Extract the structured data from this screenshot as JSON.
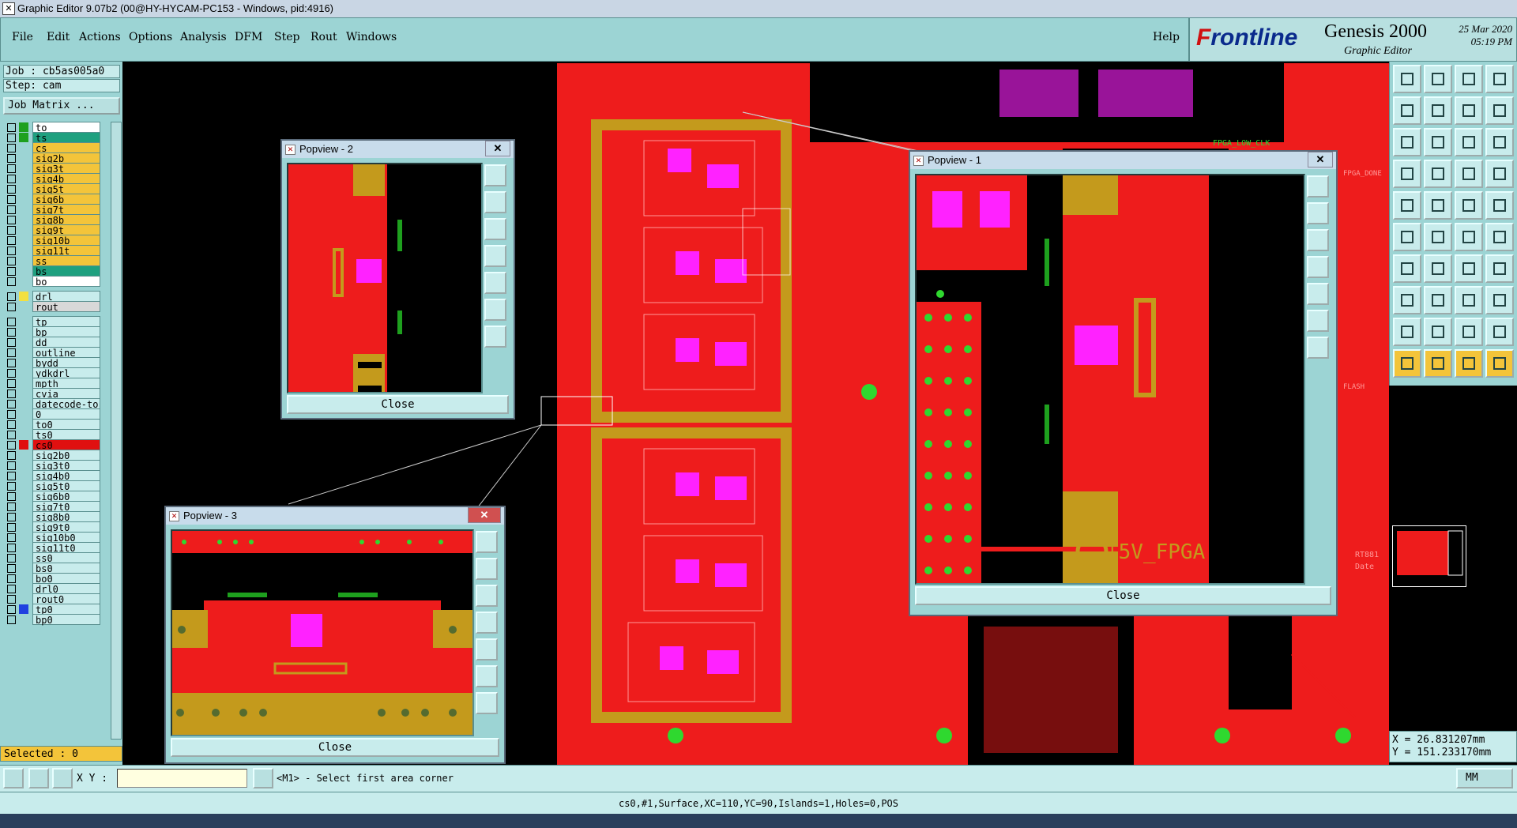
{
  "window": {
    "title": "Graphic Editor 9.07b2 (00@HY-HYCAM-PC153 - Windows, pid:4916)"
  },
  "menubar": {
    "items": [
      "File",
      "Edit",
      "Actions",
      "Options",
      "Analysis",
      "DFM",
      "Step",
      "Rout",
      "Windows"
    ],
    "help": "Help"
  },
  "brand": {
    "logo_f": "F",
    "logo_rest": "rontline",
    "product": "Genesis 2000",
    "subtitle": "Graphic Editor",
    "date": "25 Mar 2020",
    "time": "05:19 PM"
  },
  "left": {
    "job": "Job : cb5as005a0",
    "step": "Step: cam",
    "job_matrix": "Job Matrix ...",
    "layers": [
      {
        "name": "to",
        "color": "#ffffff",
        "swatch": "#1ea01e"
      },
      {
        "name": "ts",
        "color": "#1fa07f",
        "swatch": "#1ea01e"
      },
      {
        "name": "cs",
        "color": "#f3c43a",
        "swatch": ""
      },
      {
        "name": "sig2b",
        "color": "#f3c43a",
        "swatch": ""
      },
      {
        "name": "sig3t",
        "color": "#f3c43a",
        "swatch": ""
      },
      {
        "name": "sig4b",
        "color": "#f3c43a",
        "swatch": ""
      },
      {
        "name": "sig5t",
        "color": "#f3c43a",
        "swatch": ""
      },
      {
        "name": "sig6b",
        "color": "#f3c43a",
        "swatch": ""
      },
      {
        "name": "sig7t",
        "color": "#f3c43a",
        "swatch": ""
      },
      {
        "name": "sig8b",
        "color": "#f3c43a",
        "swatch": ""
      },
      {
        "name": "sig9t",
        "color": "#f3c43a",
        "swatch": ""
      },
      {
        "name": "sig10b",
        "color": "#f3c43a",
        "swatch": ""
      },
      {
        "name": "sig11t",
        "color": "#f3c43a",
        "swatch": ""
      },
      {
        "name": "ss",
        "color": "#f3c43a",
        "swatch": ""
      },
      {
        "name": "bs",
        "color": "#1fa07f",
        "swatch": ""
      },
      {
        "name": "bo",
        "color": "#ffffff",
        "swatch": ""
      },
      {
        "name": "drl",
        "color": "#c8ecec",
        "swatch": "#f3e040"
      },
      {
        "name": "rout",
        "color": "#d8d8d8",
        "swatch": ""
      },
      {
        "name": "tp",
        "color": "#c8ecec",
        "swatch": ""
      },
      {
        "name": "bp",
        "color": "#c8ecec",
        "swatch": ""
      },
      {
        "name": "dd",
        "color": "#c8ecec",
        "swatch": ""
      },
      {
        "name": "outline",
        "color": "#c8ecec",
        "swatch": ""
      },
      {
        "name": "bydd",
        "color": "#c8ecec",
        "swatch": ""
      },
      {
        "name": "ydkdrl",
        "color": "#c8ecec",
        "swatch": ""
      },
      {
        "name": "mpth",
        "color": "#c8ecec",
        "swatch": ""
      },
      {
        "name": "cvia",
        "color": "#c8ecec",
        "swatch": ""
      },
      {
        "name": "datecode-to",
        "color": "#c8ecec",
        "swatch": ""
      },
      {
        "name": "0",
        "color": "#c8ecec",
        "swatch": ""
      },
      {
        "name": "to0",
        "color": "#c8ecec",
        "swatch": ""
      },
      {
        "name": "ts0",
        "color": "#c8ecec",
        "swatch": ""
      },
      {
        "name": "cs0",
        "color": "#e01010",
        "swatch": "#e01010"
      },
      {
        "name": "sig2b0",
        "color": "#c8ecec",
        "swatch": ""
      },
      {
        "name": "sig3t0",
        "color": "#c8ecec",
        "swatch": ""
      },
      {
        "name": "sig4b0",
        "color": "#c8ecec",
        "swatch": ""
      },
      {
        "name": "sig5t0",
        "color": "#c8ecec",
        "swatch": ""
      },
      {
        "name": "sig6b0",
        "color": "#c8ecec",
        "swatch": ""
      },
      {
        "name": "sig7t0",
        "color": "#c8ecec",
        "swatch": ""
      },
      {
        "name": "sig8b0",
        "color": "#c8ecec",
        "swatch": ""
      },
      {
        "name": "sig9t0",
        "color": "#c8ecec",
        "swatch": ""
      },
      {
        "name": "sig10b0",
        "color": "#c8ecec",
        "swatch": ""
      },
      {
        "name": "sig11t0",
        "color": "#c8ecec",
        "swatch": ""
      },
      {
        "name": "ss0",
        "color": "#c8ecec",
        "swatch": ""
      },
      {
        "name": "bs0",
        "color": "#c8ecec",
        "swatch": ""
      },
      {
        "name": "bo0",
        "color": "#c8ecec",
        "swatch": ""
      },
      {
        "name": "drl0",
        "color": "#c8ecec",
        "swatch": ""
      },
      {
        "name": "rout0",
        "color": "#c8ecec",
        "swatch": ""
      },
      {
        "name": "tp0",
        "color": "#c8ecec",
        "swatch": "#2040e0"
      },
      {
        "name": "bp0",
        "color": "#c8ecec",
        "swatch": ""
      }
    ],
    "selected": "Selected : 0"
  },
  "popups": {
    "p1": {
      "title": "Popview - 1",
      "close": "Close"
    },
    "p2": {
      "title": "Popview - 2",
      "close": "Close"
    },
    "p3": {
      "title": "Popview - 3",
      "close": "Close"
    }
  },
  "board_labels": {
    "fpga": "+5V_FPGA",
    "fpga_low_clk": "FPGA_LOW_CLK",
    "fpga_done": "FPGA_DONE",
    "flash": "FLASH",
    "rt": "RT881",
    "date": "Date"
  },
  "coords": {
    "x": "X = 26.831207mm",
    "y": "Y = 151.233170mm"
  },
  "command": {
    "xy_label": "X Y :",
    "xy_value": "",
    "prompt": "<M1> - Select first area corner",
    "units": "MM"
  },
  "status": {
    "text": "cs0,#1,Surface,XC=110,YC=90,Islands=1,Holes=0,POS"
  },
  "colors": {
    "copper": "#ee1c1c",
    "gold": "#c49a1c",
    "pad": "#ff22ff",
    "green": "#2fd82f",
    "panel": "#9cd4d4"
  }
}
